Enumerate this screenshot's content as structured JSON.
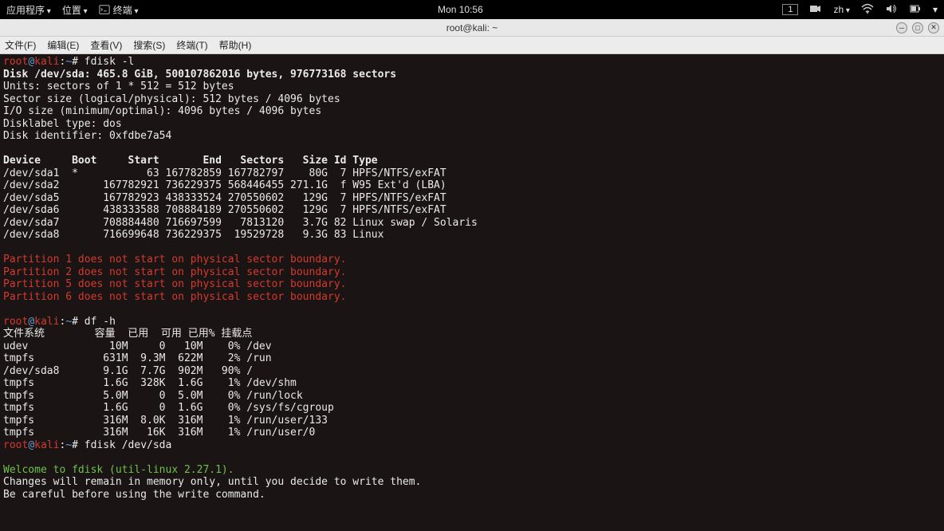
{
  "topbar": {
    "apps": "应用程序",
    "places": "位置",
    "terminal": "终端",
    "clock": "Mon 10:56",
    "workspace": "1",
    "lang": "zh"
  },
  "title": "root@kali: ~",
  "menu": {
    "file": "文件(F)",
    "edit": "编辑(E)",
    "view": "查看(V)",
    "search": "搜索(S)",
    "terminal": "终端(T)",
    "help": "帮助(H)"
  },
  "prompt": {
    "user": "root",
    "host": "kali",
    "path": "~",
    "sep": ":",
    "sym": "#"
  },
  "cmd1": "fdisk -l",
  "fdisk": {
    "line1a": "Disk /dev/sda:",
    "line1b": " 465.8 GiB, 500107862016 bytes, 976773168 sectors",
    "units": "Units: sectors of 1 * 512 = 512 bytes",
    "sector": "Sector size (logical/physical): 512 bytes / 4096 bytes",
    "io": "I/O size (minimum/optimal): 4096 bytes / 4096 bytes",
    "label": "Disklabel type: dos",
    "ident": "Disk identifier: 0xfdbe7a54",
    "hdr": "Device     Boot     Start       End   Sectors   Size Id Type",
    "r1": "/dev/sda1  *           63 167782859 167782797    80G  7 HPFS/NTFS/exFAT",
    "r2": "/dev/sda2       167782921 736229375 568446455 271.1G  f W95 Ext'd (LBA)",
    "r3": "/dev/sda5       167782923 438333524 270550602   129G  7 HPFS/NTFS/exFAT",
    "r4": "/dev/sda6       438333588 708884189 270550602   129G  7 HPFS/NTFS/exFAT",
    "r5": "/dev/sda7       708884480 716697599   7813120   3.7G 82 Linux swap / Solaris",
    "r6": "/dev/sda8       716699648 736229375  19529728   9.3G 83 Linux",
    "w1": "Partition 1 does not start on physical sector boundary.",
    "w2": "Partition 2 does not start on physical sector boundary.",
    "w3": "Partition 5 does not start on physical sector boundary.",
    "w4": "Partition 6 does not start on physical sector boundary."
  },
  "cmd2": "df -h",
  "df": {
    "hdr": "文件系统        容量  已用  可用 已用% 挂载点",
    "r1": "udev             10M     0   10M    0% /dev",
    "r2": "tmpfs           631M  9.3M  622M    2% /run",
    "r3": "/dev/sda8       9.1G  7.7G  902M   90% /",
    "r4": "tmpfs           1.6G  328K  1.6G    1% /dev/shm",
    "r5": "tmpfs           5.0M     0  5.0M    0% /run/lock",
    "r6": "tmpfs           1.6G     0  1.6G    0% /sys/fs/cgroup",
    "r7": "tmpfs           316M  8.0K  316M    1% /run/user/133",
    "r8": "tmpfs           316M   16K  316M    1% /run/user/0"
  },
  "cmd3": "fdisk /dev/sda",
  "fdiskopen": {
    "welcome": "Welcome to fdisk (util-linux 2.27.1).",
    "l1": "Changes will remain in memory only, until you decide to write them.",
    "l2": "Be careful before using the write command."
  }
}
